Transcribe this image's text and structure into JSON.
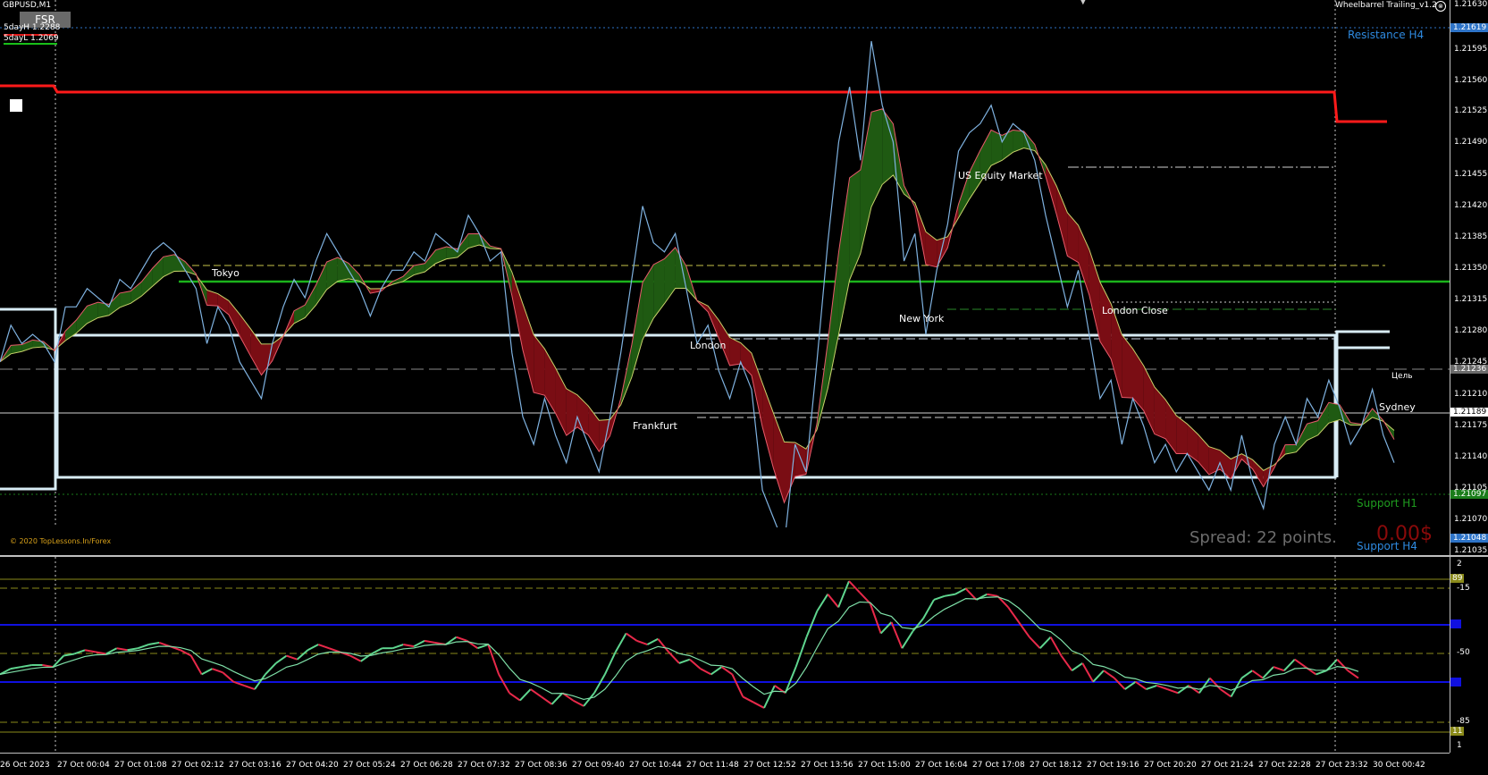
{
  "header": {
    "symbol": "GBPUSD,M1",
    "fsr_button": "FSR",
    "day_high": "5dayH 1.2288",
    "day_low": "5dayL 1.2069",
    "indicator_name": "Wheelbarrel Trailing_v1.2"
  },
  "sessions": {
    "tokyo": "Tokyo",
    "london": "London",
    "frankfurt": "Frankfurt",
    "new_york": "New York",
    "us_equity": "US Equity Market",
    "london_close": "London Close",
    "sydney": "Sydney",
    "target": "Цель"
  },
  "levels": {
    "resistance_h4": "Resistance H4",
    "support_h1": "Support H1",
    "support_h4": "Support H4"
  },
  "footer": {
    "copyright": "© 2020 TopLessons.In/Forex",
    "spread": "Spread: 22 points.",
    "profit": "0.00$"
  },
  "price_axis": {
    "ticks": [
      "1.21630",
      "1.21595",
      "1.21560",
      "1.21525",
      "1.21490",
      "1.21455",
      "1.21420",
      "1.21385",
      "1.21350",
      "1.21315",
      "1.21280",
      "1.21245",
      "1.21210",
      "1.21175",
      "1.21140",
      "1.21105",
      "1.21070",
      "1.21035"
    ],
    "marker_top": "1.21619",
    "marker_mid": "1.21236",
    "marker_current": "1.21189",
    "marker_support": "1.21097",
    "marker_bottom": "1.21048"
  },
  "osc_axis": {
    "ticks": [
      "2",
      "-15",
      "-50",
      "-85",
      "1"
    ],
    "marker_upper": "89",
    "marker_lower": "11"
  },
  "time_axis": [
    "26 Oct 2023",
    "27 Oct 00:04",
    "27 Oct 01:08",
    "27 Oct 02:12",
    "27 Oct 03:16",
    "27 Oct 04:20",
    "27 Oct 05:24",
    "27 Oct 06:28",
    "27 Oct 07:32",
    "27 Oct 08:36",
    "27 Oct 09:40",
    "27 Oct 10:44",
    "27 Oct 11:48",
    "27 Oct 12:52",
    "27 Oct 13:56",
    "27 Oct 15:00",
    "27 Oct 16:04",
    "27 Oct 17:08",
    "27 Oct 18:12",
    "27 Oct 19:16",
    "27 Oct 20:20",
    "27 Oct 21:24",
    "27 Oct 22:28",
    "27 Oct 23:32",
    "30 Oct 00:42"
  ],
  "colors": {
    "background": "#000000",
    "resistance_line": "#ff1a1a",
    "support_line": "#1bb31b",
    "range_box": "#d8ecf5",
    "bull_fill": "#1f5a12",
    "bear_fill": "#7a0d14",
    "osc_green": "#5fd68f",
    "osc_red": "#e8294a",
    "blue_level": "#1010e0",
    "olive_level": "#8a8a1a"
  },
  "price_series": [
    1.2124,
    1.2128,
    1.2126,
    1.2127,
    1.2126,
    1.2124,
    1.213,
    1.213,
    1.2132,
    1.2131,
    1.213,
    1.2133,
    1.2132,
    1.2134,
    1.2136,
    1.2137,
    1.2136,
    1.2134,
    1.2132,
    1.2126,
    1.213,
    1.2128,
    1.2124,
    1.2122,
    1.212,
    1.2126,
    1.213,
    1.2133,
    1.2131,
    1.2135,
    1.2138,
    1.2136,
    1.2134,
    1.2132,
    1.2129,
    1.2132,
    1.2134,
    1.2134,
    1.2136,
    1.2135,
    1.2138,
    1.2137,
    1.2136,
    1.214,
    1.2138,
    1.2135,
    1.2136,
    1.2125,
    1.2118,
    1.2115,
    1.212,
    1.2116,
    1.2113,
    1.2118,
    1.2115,
    1.2112,
    1.2118,
    1.2125,
    1.2133,
    1.2141,
    1.2137,
    1.2136,
    1.2138,
    1.2132,
    1.2126,
    1.2128,
    1.2123,
    1.212,
    1.2124,
    1.2121,
    1.211,
    1.2107,
    1.2104,
    1.2115,
    1.2112,
    1.2124,
    1.2137,
    1.2148,
    1.2154,
    1.2146,
    1.2159,
    1.2152,
    1.2148,
    1.2135,
    1.2138,
    1.2127,
    1.2134,
    1.2139,
    1.2147,
    1.2149,
    1.215,
    1.2152,
    1.2148,
    1.215,
    1.2149,
    1.2146,
    1.214,
    1.2135,
    1.213,
    1.2134,
    1.2127,
    1.212,
    1.2122,
    1.2115,
    1.212,
    1.2117,
    1.2113,
    1.2115,
    1.2112,
    1.2114,
    1.2112,
    1.211,
    1.2113,
    1.211,
    1.2116,
    1.2111,
    1.2108,
    1.2115,
    1.2118,
    1.2115,
    1.212,
    1.2118,
    1.2122,
    1.2119,
    1.2115,
    1.2117,
    1.2121,
    1.2116,
    1.2113
  ],
  "osc_series": [
    -58,
    -55,
    -54,
    -53,
    -53,
    -54,
    -48,
    -47,
    -45,
    -46,
    -47,
    -44,
    -45,
    -44,
    -42,
    -41,
    -43,
    -45,
    -48,
    -58,
    -55,
    -57,
    -62,
    -64,
    -66,
    -58,
    -52,
    -48,
    -50,
    -45,
    -42,
    -44,
    -46,
    -48,
    -51,
    -47,
    -44,
    -44,
    -42,
    -43,
    -40,
    -41,
    -42,
    -38,
    -40,
    -44,
    -42,
    -58,
    -68,
    -72,
    -66,
    -70,
    -74,
    -68,
    -72,
    -75,
    -68,
    -58,
    -46,
    -36,
    -40,
    -42,
    -39,
    -46,
    -52,
    -50,
    -55,
    -58,
    -54,
    -58,
    -70,
    -73,
    -76,
    -64,
    -68,
    -54,
    -38,
    -24,
    -15,
    -22,
    -8,
    -14,
    -20,
    -36,
    -30,
    -44,
    -35,
    -28,
    -18,
    -16,
    -15,
    -12,
    -18,
    -15,
    -16,
    -22,
    -30,
    -38,
    -44,
    -38,
    -48,
    -56,
    -52,
    -62,
    -56,
    -60,
    -66,
    -62,
    -66,
    -64,
    -66,
    -68,
    -64,
    -68,
    -60,
    -66,
    -70,
    -60,
    -56,
    -60,
    -54,
    -56,
    -50,
    -54,
    -58,
    -56,
    -50,
    -56,
    -60
  ]
}
